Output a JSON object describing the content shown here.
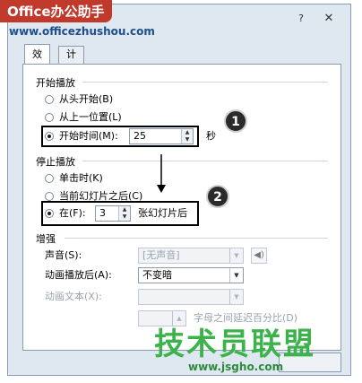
{
  "watermark": {
    "brand": "Office办公助手",
    "url": "www.officezhushou.com",
    "logo_text": "技术员联盟",
    "logo_url": "www.jsgho.com"
  },
  "titlebar": {
    "help_label": "?",
    "close_label": "✕"
  },
  "tabs": [
    {
      "label": "效果",
      "active": true
    },
    {
      "label": "计时",
      "active": false
    }
  ],
  "start_group": {
    "title": "开始播放",
    "options": [
      {
        "label": "从头开始(B)",
        "checked": false
      },
      {
        "label": "从上一位置(L)",
        "checked": false
      },
      {
        "label": "开始时间(M):",
        "checked": true
      }
    ],
    "start_time_value": "25",
    "start_time_unit": "秒"
  },
  "stop_group": {
    "title": "停止播放",
    "options": [
      {
        "label": "单击时(K)",
        "checked": false
      },
      {
        "label": "当前幻灯片之后(C)",
        "checked": false
      },
      {
        "label": "在(F):",
        "checked": true
      }
    ],
    "after_slides_value": "3",
    "after_slides_unit": "张幻灯片后"
  },
  "enhance_group": {
    "title": "增强",
    "sound_label": "声音(S):",
    "sound_value": "[无声音]",
    "after_anim_label": "动画播放后(A):",
    "after_anim_value": "不变暗",
    "anim_text_label": "动画文本(X):",
    "anim_text_value": "",
    "delay_label": "字母之间延迟百分比(D)",
    "delay_value": ""
  },
  "annotations": {
    "badge1": "1",
    "badge2": "2"
  },
  "icons": [
    "help-icon",
    "close-icon",
    "speaker-icon",
    "spin-up-icon",
    "spin-down-icon",
    "dropdown-arrow-icon",
    "arrow-down-icon"
  ]
}
